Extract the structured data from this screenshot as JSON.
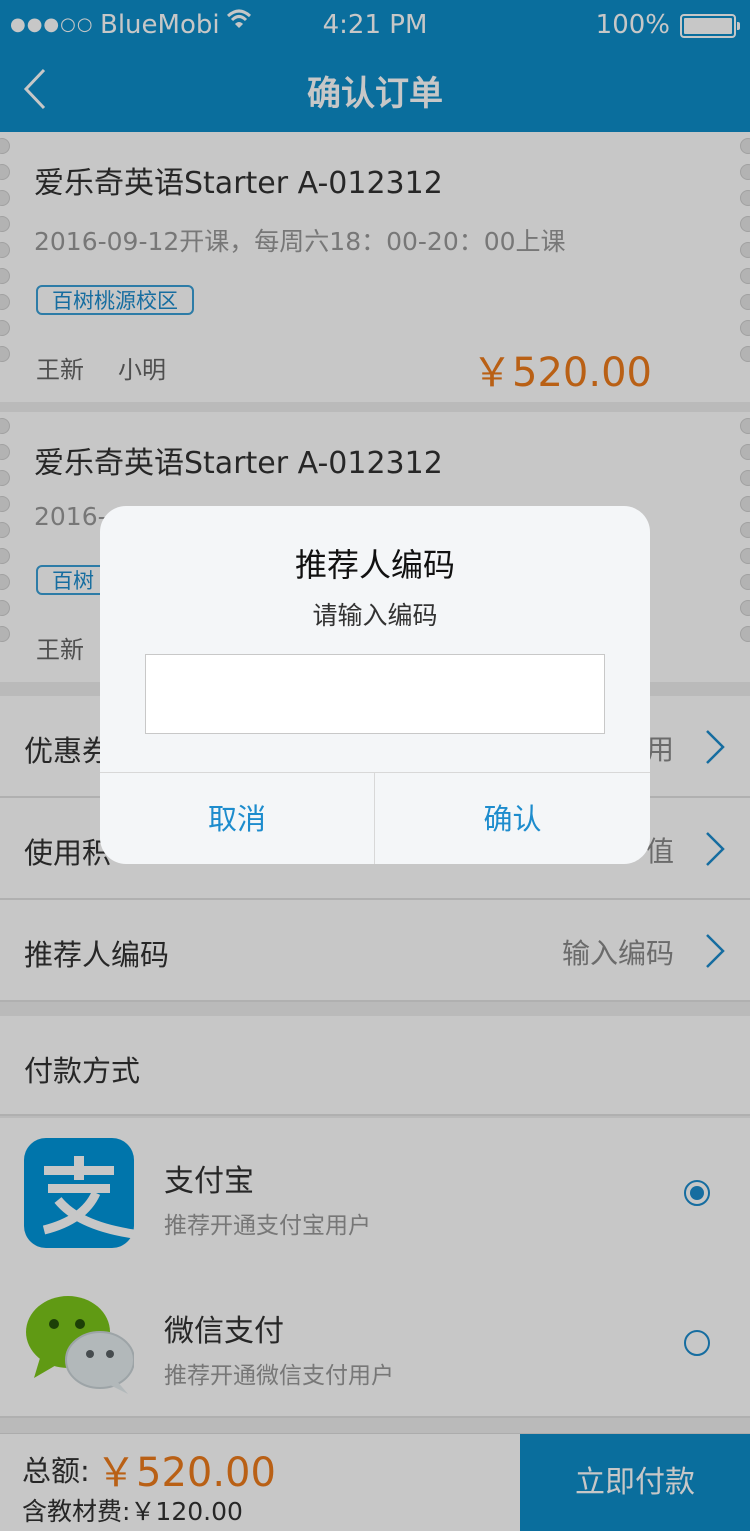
{
  "status_bar": {
    "signal": "●●●○○",
    "carrier": "BlueMobi",
    "time": "4:21 PM",
    "battery": "100%"
  },
  "nav": {
    "title": "确认订单"
  },
  "courses": [
    {
      "name": "爱乐奇英语Starter A-012312",
      "schedule": "2016-09-12开课，每周六18：00-20：00上课",
      "campus": "百树桃源校区",
      "teacher": "王新",
      "student": "小明",
      "price": "￥520.00"
    },
    {
      "name": "爱乐奇英语Starter A-012312",
      "schedule": "2016-",
      "campus": "百树",
      "teacher": "王新"
    }
  ],
  "rows": [
    {
      "label": "优惠券",
      "value": "用"
    },
    {
      "label": "使用积",
      "value": "值"
    },
    {
      "label": "推荐人编码",
      "value": "输入编码"
    }
  ],
  "payment": {
    "title": "付款方式",
    "methods": [
      {
        "name": "支付宝",
        "desc": "推荐开通支付宝用户",
        "selected": true,
        "icon": "alipay-logo"
      },
      {
        "name": "微信支付",
        "desc": "推荐开通微信支付用户",
        "selected": false,
        "icon": "wechat-logo"
      }
    ]
  },
  "bottom": {
    "total_label": "总额:",
    "total_amount": "￥520.00",
    "material_fee": "含教材费:￥120.00",
    "pay_button": "立即付款"
  },
  "dialog": {
    "title": "推荐人编码",
    "subtitle": "请输入编码",
    "input_value": "",
    "cancel": "取消",
    "confirm": "确认"
  },
  "colors": {
    "primary": "#0e8ec9",
    "price": "#ee7b1c",
    "link": "#1d8ccd"
  }
}
